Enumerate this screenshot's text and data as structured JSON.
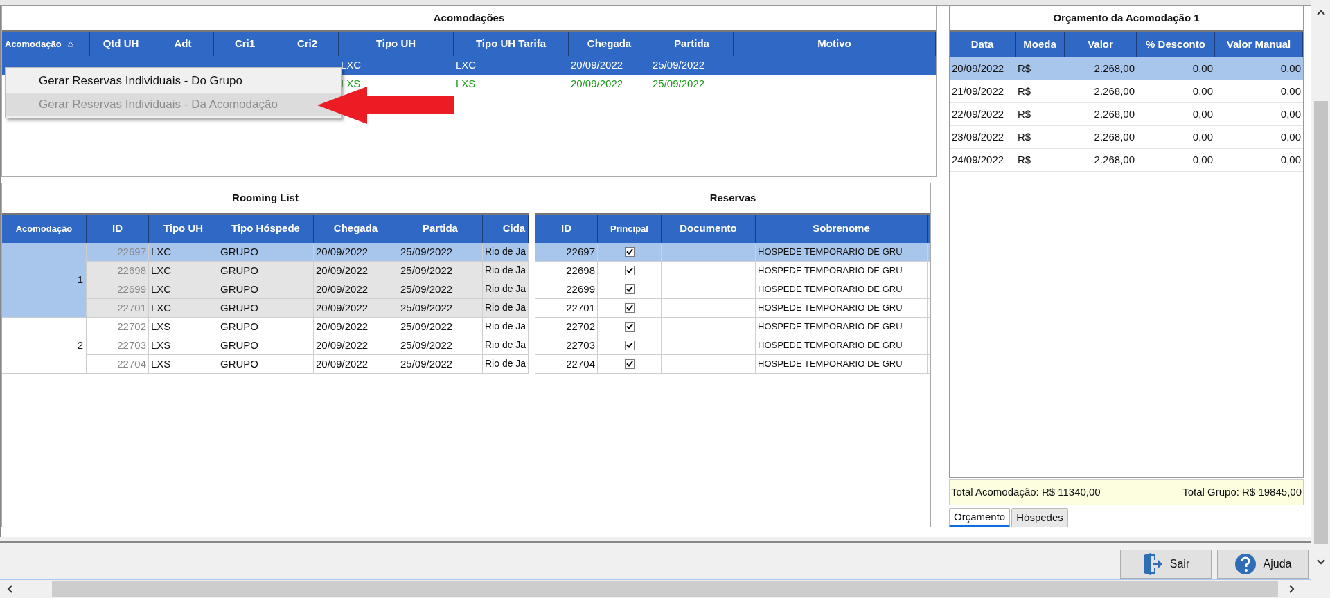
{
  "accommodations": {
    "title": "Acomodações",
    "columns": [
      {
        "label": "Acomodação",
        "sorted": true
      },
      {
        "label": "Qtd UH",
        "sorted": false
      },
      {
        "label": "Adt",
        "sorted": false
      },
      {
        "label": "Cri1",
        "sorted": false
      },
      {
        "label": "Cri2",
        "sorted": false
      },
      {
        "label": "Tipo UH",
        "sorted": false
      },
      {
        "label": "Tipo UH Tarifa",
        "sorted": false
      },
      {
        "label": "Chegada",
        "sorted": false
      },
      {
        "label": "Partida",
        "sorted": false
      },
      {
        "label": "Motivo",
        "sorted": false
      }
    ],
    "rows": [
      {
        "selected": true,
        "color": "#ffffff",
        "cells": [
          null,
          null,
          null,
          null,
          null,
          "LXC",
          "LXC",
          "20/09/2022",
          "25/09/2022",
          null
        ]
      },
      {
        "selected": false,
        "color": "#1a9a1a",
        "cells": [
          null,
          null,
          null,
          null,
          null,
          "LXS",
          "LXS",
          "20/09/2022",
          "25/09/2022",
          null
        ]
      }
    ]
  },
  "context_menu": {
    "items": [
      {
        "label": "Gerar Reservas Individuais - Do Grupo",
        "disabled": false,
        "selected": false
      },
      {
        "label": "Gerar Reservas Individuais - Da Acomodação",
        "disabled": true,
        "selected": true
      }
    ]
  },
  "rooming_list": {
    "title": "Rooming List",
    "columns": [
      "Acomodação",
      "ID",
      "Tipo UH",
      "Tipo Hóspede",
      "Chegada",
      "Partida",
      "Cida"
    ],
    "groups": [
      {
        "acomodacao": "1",
        "selected": true,
        "rows": [
          {
            "selected": true,
            "cells": [
              "22697",
              "LXC",
              "GRUPO",
              "20/09/2022",
              "25/09/2022",
              "Rio de Ja"
            ]
          },
          {
            "selected": false,
            "cells": [
              "22698",
              "LXC",
              "GRUPO",
              "20/09/2022",
              "25/09/2022",
              "Rio de Ja"
            ]
          },
          {
            "selected": false,
            "cells": [
              "22699",
              "LXC",
              "GRUPO",
              "20/09/2022",
              "25/09/2022",
              "Rio de Ja"
            ]
          },
          {
            "selected": false,
            "cells": [
              "22701",
              "LXC",
              "GRUPO",
              "20/09/2022",
              "25/09/2022",
              "Rio de Ja"
            ]
          }
        ]
      },
      {
        "acomodacao": "2",
        "selected": false,
        "rows": [
          {
            "selected": false,
            "cells": [
              "22702",
              "LXS",
              "GRUPO",
              "20/09/2022",
              "25/09/2022",
              "Rio de Ja"
            ]
          },
          {
            "selected": false,
            "cells": [
              "22703",
              "LXS",
              "GRUPO",
              "20/09/2022",
              "25/09/2022",
              "Rio de Ja"
            ]
          },
          {
            "selected": false,
            "cells": [
              "22704",
              "LXS",
              "GRUPO",
              "20/09/2022",
              "25/09/2022",
              "Rio de Ja"
            ]
          }
        ]
      }
    ]
  },
  "reservations": {
    "title": "Reservas",
    "columns": [
      "ID",
      "Principal",
      "Documento",
      "Sobrenome"
    ],
    "rows": [
      {
        "selected": true,
        "id": "22697",
        "principal": true,
        "surname": "HOSPEDE TEMPORARIO DE GRU"
      },
      {
        "selected": false,
        "id": "22698",
        "principal": true,
        "surname": "HOSPEDE TEMPORARIO DE GRU"
      },
      {
        "selected": false,
        "id": "22699",
        "principal": true,
        "surname": "HOSPEDE TEMPORARIO DE GRU"
      },
      {
        "selected": false,
        "id": "22701",
        "principal": true,
        "surname": "HOSPEDE TEMPORARIO DE GRU"
      },
      {
        "selected": false,
        "id": "22702",
        "principal": true,
        "surname": "HOSPEDE TEMPORARIO DE GRU"
      },
      {
        "selected": false,
        "id": "22703",
        "principal": true,
        "surname": "HOSPEDE TEMPORARIO DE GRU"
      },
      {
        "selected": false,
        "id": "22704",
        "principal": true,
        "surname": "HOSPEDE TEMPORARIO DE GRU"
      }
    ]
  },
  "budget": {
    "title": "Orçamento da Acomodação 1",
    "columns": [
      "Data",
      "Moeda",
      "Valor",
      "% Desconto",
      "Valor Manual"
    ],
    "rows": [
      {
        "selected": true,
        "cells": [
          "20/09/2022",
          "R$",
          "2.268,00",
          "0,00",
          "0,00"
        ]
      },
      {
        "selected": false,
        "cells": [
          "21/09/2022",
          "R$",
          "2.268,00",
          "0,00",
          "0,00"
        ]
      },
      {
        "selected": false,
        "cells": [
          "22/09/2022",
          "R$",
          "2.268,00",
          "0,00",
          "0,00"
        ]
      },
      {
        "selected": false,
        "cells": [
          "23/09/2022",
          "R$",
          "2.268,00",
          "0,00",
          "0,00"
        ]
      },
      {
        "selected": false,
        "cells": [
          "24/09/2022",
          "R$",
          "2.268,00",
          "0,00",
          "0,00"
        ]
      }
    ],
    "total_accommodation": "Total Acomodação: R$ 11340,00",
    "total_group": "Total Grupo: R$ 19845,00",
    "tabs": [
      {
        "label": "Orçamento",
        "selected": true
      },
      {
        "label": "Hóspedes",
        "selected": false
      }
    ]
  },
  "buttons": [
    {
      "label": "Sair",
      "kind": "exit"
    },
    {
      "label": "Ajuda",
      "kind": "help"
    }
  ]
}
